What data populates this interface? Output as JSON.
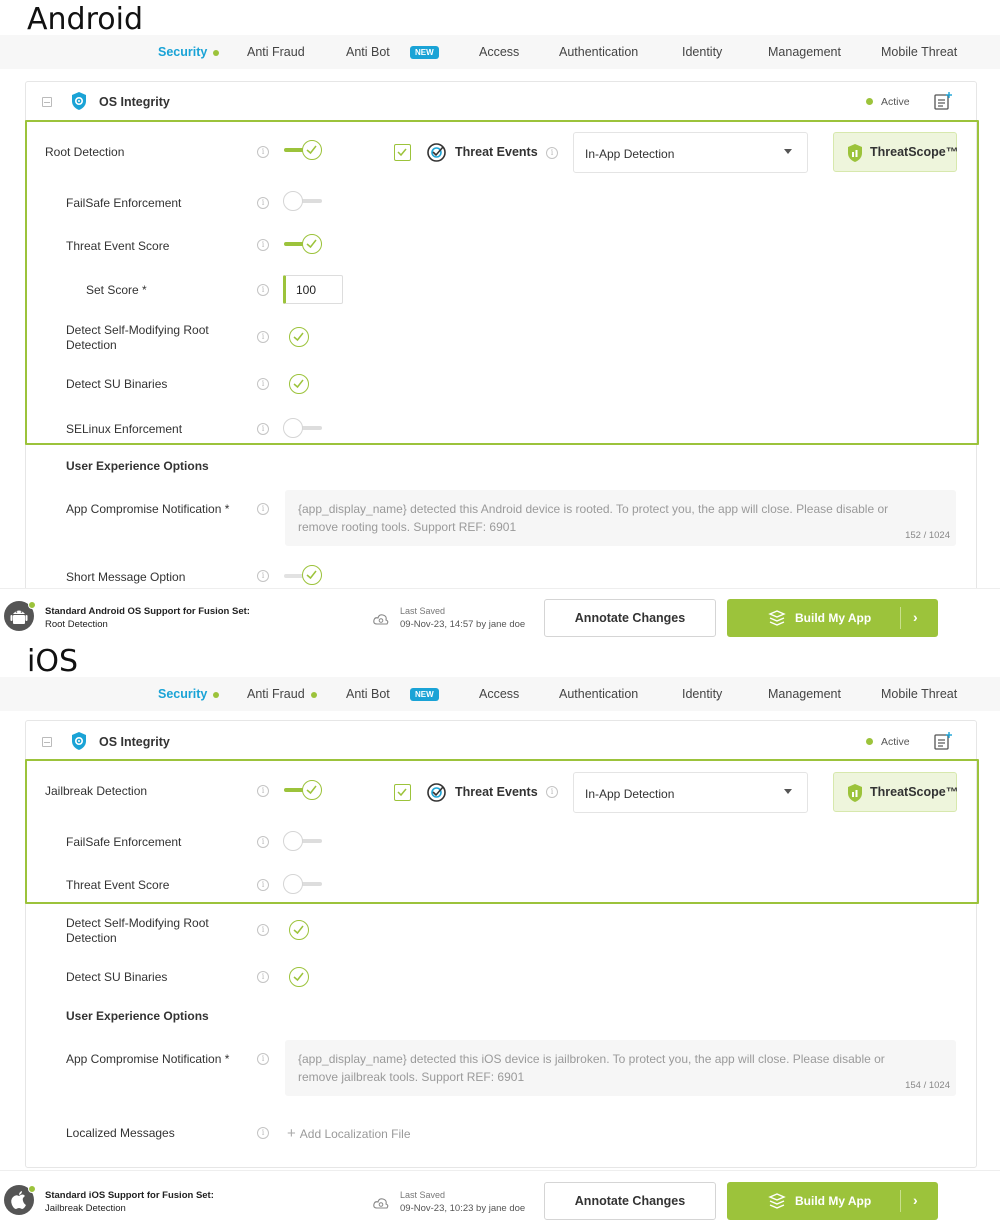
{
  "colors": {
    "accent": "#9cc33b",
    "nav_active": "#1aa3d6",
    "new_badge": "#1aa3d6"
  },
  "android": {
    "platform_label": "Android",
    "nav": {
      "items": [
        "Security",
        "Anti Fraud",
        "Anti Bot",
        "Access",
        "Authentication",
        "Identity",
        "Management",
        "Mobile Threat"
      ],
      "new_badge": "NEW"
    },
    "card": {
      "title": "OS Integrity",
      "status": "Active",
      "root_detection": {
        "label": "Root Detection",
        "enabled": true
      },
      "threat_events": {
        "label": "Threat Events",
        "checked": true
      },
      "detection_select": {
        "value": "In-App Detection"
      },
      "threatscope": {
        "label": "ThreatScope™"
      },
      "failsafe": {
        "label": "FailSafe Enforcement",
        "enabled": false
      },
      "threat_event_score": {
        "label": "Threat Event Score",
        "enabled": true
      },
      "set_score": {
        "label": "Set Score",
        "required": "*",
        "value": "100"
      },
      "self_modifying": {
        "label": "Detect Self-Modifying Root Detection",
        "checked": true
      },
      "su_binaries": {
        "label": "Detect SU Binaries",
        "checked": true
      },
      "selinux": {
        "label": "SELinux Enforcement",
        "enabled": false
      },
      "ux_heading": "User Experience Options",
      "notification": {
        "label": "App Compromise Notification",
        "required": "*",
        "text": "{app_display_name} detected this Android device is rooted. To protect you, the app will close. Please disable or remove rooting tools. Support REF: 6901",
        "count": "152 / 1024"
      },
      "short_message": {
        "label": "Short Message Option",
        "enabled": true
      }
    },
    "footer": {
      "title": "Standard Android OS Support for Fusion Set:",
      "subtitle": "Root Detection",
      "last_saved_label": "Last Saved",
      "last_saved_value": "09-Nov-23, 14:57 by jane doe",
      "annotate": "Annotate Changes",
      "build": "Build My App"
    }
  },
  "ios": {
    "platform_label": "iOS",
    "nav": {
      "items": [
        "Security",
        "Anti Fraud",
        "Anti Bot",
        "Access",
        "Authentication",
        "Identity",
        "Management",
        "Mobile Threat"
      ],
      "new_badge": "NEW"
    },
    "card": {
      "title": "OS Integrity",
      "status": "Active",
      "jailbreak_detection": {
        "label": "Jailbreak Detection",
        "enabled": true
      },
      "threat_events": {
        "label": "Threat Events",
        "checked": true
      },
      "detection_select": {
        "value": "In-App Detection"
      },
      "threatscope": {
        "label": "ThreatScope™"
      },
      "failsafe": {
        "label": "FailSafe Enforcement",
        "enabled": false
      },
      "threat_event_score": {
        "label": "Threat Event Score",
        "enabled": false
      },
      "self_modifying": {
        "label": "Detect Self-Modifying Root Detection",
        "checked": true
      },
      "su_binaries": {
        "label": "Detect SU Binaries",
        "checked": true
      },
      "ux_heading": "User Experience Options",
      "notification": {
        "label": "App Compromise Notification",
        "required": "*",
        "text": "{app_display_name} detected this iOS device is jailbroken. To protect you, the app will close. Please disable or remove jailbreak tools. Support REF: 6901",
        "count": "154 / 1024"
      },
      "localized": {
        "label": "Localized Messages",
        "add": "Add Localization File"
      }
    },
    "footer": {
      "title": "Standard iOS Support for Fusion Set:",
      "subtitle": "Jailbreak Detection",
      "last_saved_label": "Last Saved",
      "last_saved_value": "09-Nov-23, 10:23 by jane doe",
      "annotate": "Annotate Changes",
      "build": "Build My App"
    }
  }
}
